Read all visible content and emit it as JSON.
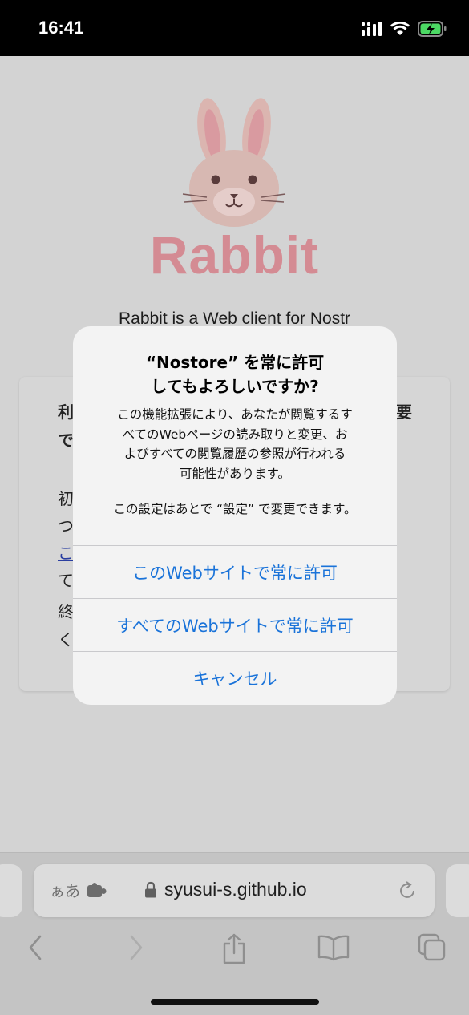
{
  "status": {
    "time": "16:41",
    "icons": [
      "cellular-signal-icon",
      "wifi-icon",
      "battery-charging-icon"
    ]
  },
  "page": {
    "brand": "Rabbit",
    "tagline": "Rabbit is a Web client for Nostr",
    "card_fragments": {
      "heading_a": "利",
      "heading_b": "要",
      "heading_c": "で",
      "p1": "初",
      "p2": "つ",
      "link": "こ",
      "p3": "て",
      "p4": "終",
      "p5": "く"
    }
  },
  "alert": {
    "title": "“Nostore” を常に許可\nしてもよろしいですか?",
    "message": "この機能拡張により、あなたが閲覧するす\nべてのWebページの読み取りと変更、お\nよびすべての閲覧履歴の参照が行われる\n可能性があります。",
    "note": "この設定はあとで “設定” で変更できます。",
    "buttons": [
      {
        "label": "このWebサイトで常に許可"
      },
      {
        "label": "すべてのWebサイトで常に許可"
      },
      {
        "label": "キャンセル"
      }
    ]
  },
  "browser": {
    "text_size_label": "ぁあ",
    "url": "syusui-s.github.io",
    "toolbar": [
      "back-icon",
      "forward-icon",
      "share-icon",
      "bookmarks-icon",
      "tabs-icon"
    ]
  },
  "colors": {
    "accent": "#1a73d9",
    "brand": "#d48b93"
  }
}
